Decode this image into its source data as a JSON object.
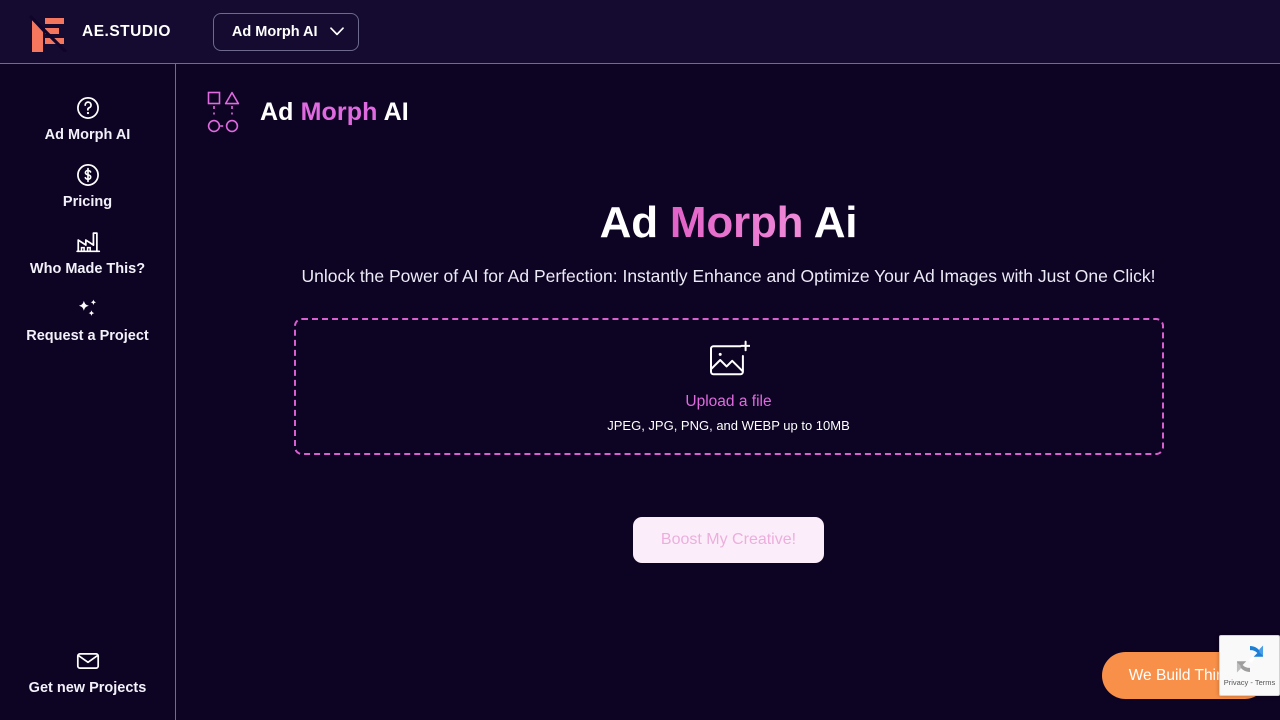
{
  "topbar": {
    "logo_icon": "ae-studio-logo-icon",
    "brand_name": "AE.STUDIO",
    "app_selector": {
      "label": "Ad Morph AI",
      "chevron_icon": "chevron-down-icon"
    }
  },
  "sidebar": {
    "items": [
      {
        "label": "Ad Morph AI",
        "icon": "question-circle-icon"
      },
      {
        "label": "Pricing",
        "icon": "dollar-circle-icon"
      },
      {
        "label": "Who Made This?",
        "icon": "factory-icon"
      },
      {
        "label": "Request a Project",
        "icon": "sparkles-icon"
      }
    ],
    "bottom_item": {
      "label": "Get new Projects",
      "icon": "envelope-icon"
    }
  },
  "page": {
    "mark_icon": "morph-shapes-icon",
    "title_part1": "Ad ",
    "title_accent": "Morph",
    "title_part2": " AI"
  },
  "hero": {
    "title_part1": "Ad ",
    "title_accent": "Morph",
    "title_part2": " Ai",
    "subtitle": "Unlock the Power of AI for Ad Perfection: Instantly Enhance and Optimize Your Ad Images with Just One Click!"
  },
  "dropzone": {
    "icon": "image-plus-icon",
    "primary_text": "Upload a file",
    "secondary_text": "JPEG, JPG, PNG, and WEBP up to 10MB"
  },
  "cta": {
    "label": "Boost My Creative!"
  },
  "widgets": {
    "we_build_things": "We Build Things",
    "recaptcha": {
      "icon": "recaptcha-icon",
      "text": "Privacy - Terms"
    }
  },
  "colors": {
    "background": "#0d0322",
    "topbar": "#150a30",
    "border_purple": "#9b4fb5",
    "accent_pink": "#e06ae0",
    "dropzone_border": "#d95fd0",
    "cta_bg": "#fbeefa",
    "cta_text": "#edaedd",
    "orange": "#f99049"
  }
}
